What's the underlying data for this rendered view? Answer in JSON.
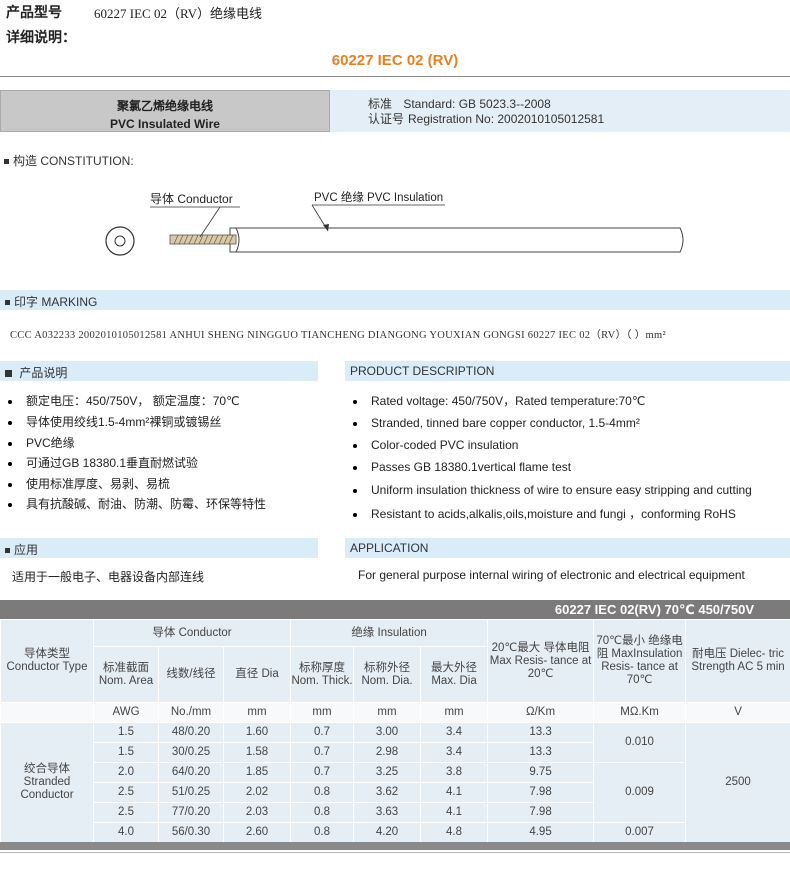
{
  "header": {
    "model_label": "产品型号",
    "model_value": "60227 IEC 02（RV）绝缘电线",
    "detail_label": "详细说明：",
    "title": "60227 IEC 02 (RV)"
  },
  "type_box": {
    "name_zh": "聚氯乙烯绝缘电线",
    "name_en": "PVC Insulated Wire",
    "standard_label": "标准",
    "standard_value": "Standard: GB 5023.3--2008",
    "cert_label": "认证号",
    "cert_value": "Registration No: 2002010105012581"
  },
  "constitution": {
    "label": "构造  CONSTITUTION:",
    "conductor_label": "导体 Conductor",
    "insulation_label": "PVC 绝缘 PVC Insulation"
  },
  "marking": {
    "label": "印字  MARKING",
    "text": "CCC    A032233    2002010105012581    ANHUI  SHENG  NINGGUO  TIANCHENG  DIANGONG  YOUXIAN  GONGSI  60227 IEC 02（RV）（  ）mm²"
  },
  "product_description": {
    "zh_title": "产品说明",
    "en_title": "PRODUCT DESCRIPTION",
    "zh_items": [
      "额定电压：450/750V，  额定温度：70℃",
      "导体使用绞线1.5-4mm²裸铜或镀锡丝",
      "PVC绝缘",
      "可通过GB 18380.1垂直耐燃试验",
      "使用标准厚度、易剥、易梳",
      "具有抗酸碱、耐油、防潮、防霉、环保等特性"
    ],
    "en_items": [
      "Rated voltage: 450/750V，Rated temperature:70℃",
      "Stranded, tinned bare copper conductor, 1.5-4mm²",
      "Color-coded PVC insulation",
      "Passes GB 18380.1vertical flame test",
      "Uniform insulation thickness of wire to ensure easy stripping and cutting",
      "Resistant to acids,alkalis,oils,moisture and fungi ，conforming RoHS"
    ]
  },
  "application": {
    "zh_title": "应用",
    "en_title": "APPLICATION",
    "zh_text": "适用于一般电子、电器设备内部连线",
    "en_text": "For general purpose internal wiring of electronic and electrical equipment"
  },
  "table": {
    "title": "60227 IEC 02(RV)  70℃ 450/750V",
    "h_type": "导体类型 Conductor Type",
    "h_conductor": "导体 Conductor",
    "h_insulation": "绝缘 Insulation",
    "h_resist20": "20℃最大 导体电阻 Max Resis- tance at 20℃",
    "h_resist70": "70℃最小 绝缘电阻 MaxInsulation Resis- tance at 70℃",
    "h_dielectric": "耐电压 Dielec- tric Strength AC 5 min",
    "h_area": "标准截面 Nom. Area",
    "h_strand": "线数/线径",
    "h_dia": "直径  Dia",
    "h_thick": "标称厚度 Nom. Thick.",
    "h_od": "标称外径 Nom. Dia.",
    "h_maxdia": "最大外径 Max. Dia",
    "units": [
      "AWG",
      "No./mm",
      "mm",
      "mm",
      "mm",
      "mm",
      "Ω/Km",
      "MΩ.Km",
      "V"
    ],
    "type_value": "绞合导体 Stranded Conductor",
    "rows": [
      [
        "1.5",
        "48/0.20",
        "1.60",
        "0.7",
        "3.00",
        "3.4",
        "13.3"
      ],
      [
        "1.5",
        "30/0.25",
        "1.58",
        "0.7",
        "2.98",
        "3.4",
        "13.3"
      ],
      [
        "2.0",
        "64/0.20",
        "1.85",
        "0.7",
        "3.25",
        "3.8",
        "9.75"
      ],
      [
        "2.5",
        "51/0.25",
        "2.02",
        "0.8",
        "3.62",
        "4.1",
        "7.98"
      ],
      [
        "2.5",
        "77/0.20",
        "2.03",
        "0.8",
        "3.63",
        "4.1",
        "7.98"
      ],
      [
        "4.0",
        "56/0.30",
        "2.60",
        "0.8",
        "4.20",
        "4.8",
        "4.95"
      ]
    ],
    "insul_res": [
      "0.010",
      "0.009",
      "0.007"
    ],
    "dielectric_value": "2500"
  }
}
